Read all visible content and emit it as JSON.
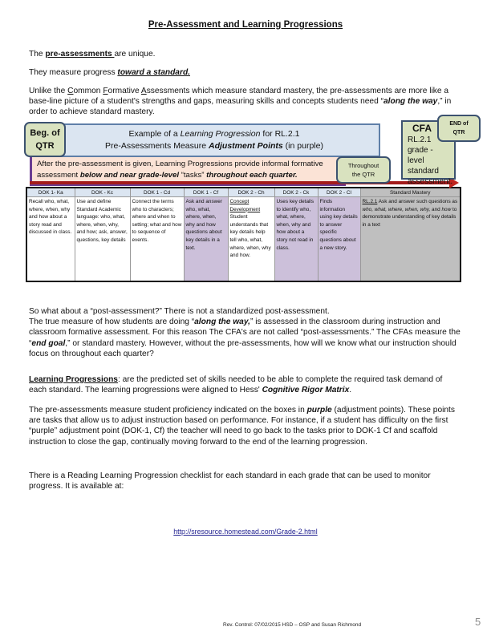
{
  "title": "Pre-Assessment and Learning Progressions",
  "intro": {
    "line1_pre": "The ",
    "line1_link": "pre-assessments ",
    "line1_post": "are unique.",
    "line2_pre": "They measure progress ",
    "line2_emph": "toward a standard.",
    "para_pre": "Unlike the ",
    "cfa_c": "C",
    "cfa_c_rest": "ommon ",
    "cfa_f": "F",
    "cfa_f_rest": "ormative ",
    "cfa_a": "A",
    "cfa_a_rest": "ssessments which measure standard mastery, the pre-assessments are more like a base-line picture of a student's strengths and gaps, measuring skills and concepts students need “",
    "para_emph": "along the way",
    "para_post": ",” in order to achieve standard mastery."
  },
  "diagram": {
    "beg_label_1": "Beg. of",
    "beg_label_2": "QTR",
    "example_pre": "Example of a ",
    "example_emph": "Learning Progression",
    "example_post": " for RL.2.1",
    "measure_pre": "Pre-Assessments Measure ",
    "measure_emph": "Adjustment Points",
    "measure_post": " (in purple)",
    "after_line1": "After the pre-assessment is given, Learning Progressions provide informal formative",
    "after_line2_pre": "assessment ",
    "after_line2_emph": "below and near grade-level",
    "after_line2_mid": "  “tasks” ",
    "after_line2_emph2": "throughout each quarter.",
    "throughout_1": "Throughout",
    "throughout_2": "the QTR",
    "cfa_title": "CFA",
    "cfa_body": "RL.2.1 grade -level standard assessment.",
    "end_1": "END of",
    "end_2": "QTR",
    "colors": {
      "adjustment_purple": "#ccc0da",
      "milestone_green": "#d9e2bf",
      "arrow_red": "#a31b1b"
    }
  },
  "table": {
    "headers": [
      "DOK 1- Ka",
      "DOK - Kc",
      "DOK 1 - Cd",
      "DOK 1 - Cf",
      "DOK 2 - Ch",
      "DOK 2 - Ck",
      "DOK 2 - Cl",
      "Standard Mastery"
    ],
    "cells": [
      "Recall who, what, where, when, why and how about a story read and discussed in class.",
      "Use and define Standard Academic language: who, what, where, when, why, and how; ask, answer, questions, key details",
      "Connect the terms who to characters; where and when to setting; what and how to sequence of events.",
      "Ask and answer who, what, where, when, why and how questions about key details in a text.",
      "Student understands that key details help tell who, what, where, when, why and how.",
      "Uses key details to identify who, what, where, when, why and how about a story not read in class.",
      "Finds information using key details to answer specific questions about a new story.",
      ""
    ],
    "concept_dev_label": "Concept Development",
    "mastery": {
      "code": "RL.2.1",
      "text_1": " Ask and answer such questions as ",
      "emph_1": "who, what, where, when, why,",
      "text_2": " and ",
      "emph_2": "how",
      "text_3": " to demonstrate understanding of key details in a text"
    }
  },
  "post": {
    "line1": "So what about a “post-assessment?”  There is not a standardized post-assessment.",
    "line2_pre": "The true measure of how students are doing “",
    "line2_emph": "along the way,",
    "line2_post": "” is assessed in the classroom during instruction and classroom formative assessment.  For this reason The CFA's are not called  “post-assessments.”  The CFAs measure the “",
    "end_goal": "end goal",
    "line3_post": ",” or standard mastery.  However, without the pre-assessments, how will we know what our instruction should focus on throughout each quarter?"
  },
  "learning_progressions": {
    "term": "Learning Progressions",
    "text": ": are the predicted set of skills needed to be able to complete the required task demand of each standard. The learning progressions were aligned to Hess' ",
    "matrix": "Cognitive Rigor Matrix",
    "end": "."
  },
  "preassess_para": {
    "pre": "The pre-assessments measure student proficiency indicated on the boxes in ",
    "purple": "purple",
    "post": " (adjustment points). These points are tasks that allow us to adjust instruction based on performance.  For instance, if a student has difficulty on the first “purple” adjustment point (DOK-1, Cf) the teacher will need to go back to the tasks prior to DOK-1 Cf and scaffold instruction to close the gap, continually moving forward to the end of the learning progression."
  },
  "checklist_para": "There is a Reading Learning Progression checklist for each standard in each grade that can be used to monitor progress.  It is available at:",
  "link": "http://sresource.homestead.com/Grade-2.html",
  "footer": "Rev. Control: 07/02/2015 HSD – OSP and Susan Richmond",
  "page_number": "5"
}
